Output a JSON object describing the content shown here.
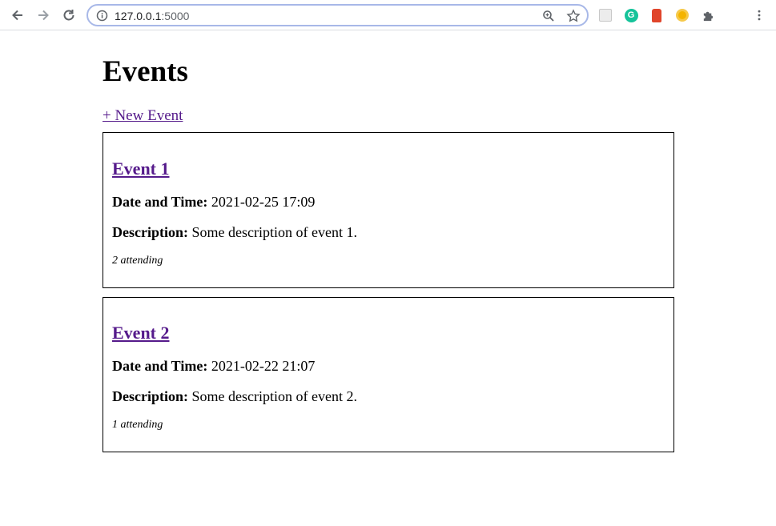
{
  "browser": {
    "url_host": "127.0.0.1",
    "url_port": ":5000"
  },
  "page": {
    "title": "Events",
    "new_event_label": "+ New Event"
  },
  "events": [
    {
      "title": "Event 1",
      "datetime_label": "Date and Time:",
      "datetime": "2021-02-25 17:09",
      "description_label": "Description:",
      "description": "Some description of event 1.",
      "attending": "2 attending"
    },
    {
      "title": "Event 2",
      "datetime_label": "Date and Time:",
      "datetime": "2021-02-22 21:07",
      "description_label": "Description:",
      "description": "Some description of event 2.",
      "attending": "1 attending"
    }
  ],
  "icons": {
    "back": "arrow-left-icon",
    "forward": "arrow-right-icon",
    "reload": "reload-icon",
    "info": "info-icon",
    "zoom": "zoom-icon",
    "bookmark": "star-icon",
    "extensions": [
      "extension-grey-icon",
      "grammarly-icon",
      "extension-red-icon",
      "extension-orange-icon",
      "puzzle-icon"
    ],
    "menu": "kebab-menu-icon"
  },
  "colors": {
    "link_visited": "#551a8b",
    "omnibox_border": "#a8b8e8",
    "grammarly": "#15c39a",
    "ext_red": "#e0452b",
    "ext_orange": "#f4b400"
  }
}
